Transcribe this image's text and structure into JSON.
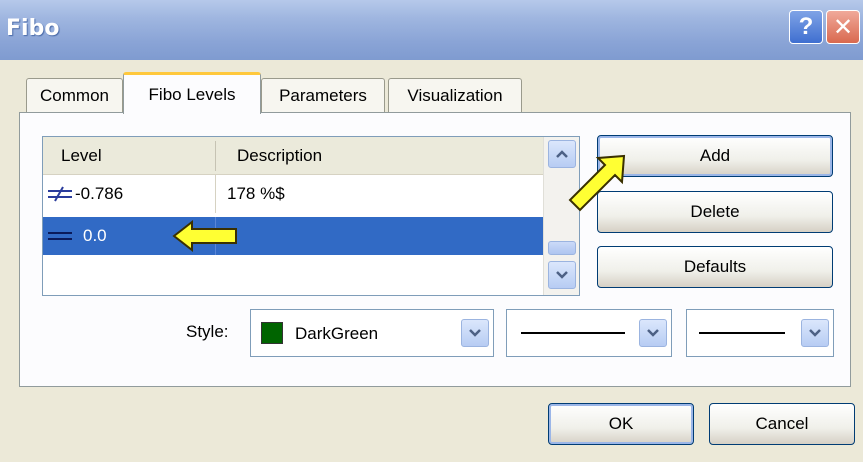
{
  "window": {
    "title": "Fibo"
  },
  "titlebar_buttons": {
    "help": "?",
    "close": "✕"
  },
  "tabs": [
    {
      "label": "Common",
      "active": false
    },
    {
      "label": "Fibo Levels",
      "active": true
    },
    {
      "label": "Parameters",
      "active": false
    },
    {
      "label": "Visualization",
      "active": false
    }
  ],
  "levels_list": {
    "columns": [
      "Level",
      "Description"
    ],
    "rows": [
      {
        "level": "-0.786",
        "description": "178 %$",
        "selected": false
      },
      {
        "level": "0.0",
        "description": "",
        "selected": true
      }
    ]
  },
  "buttons": {
    "add": "Add",
    "delete": "Delete",
    "defaults": "Defaults",
    "ok": "OK",
    "cancel": "Cancel"
  },
  "style": {
    "label": "Style:",
    "color_name": "DarkGreen",
    "color_hex": "#006400",
    "line_style": "solid",
    "line_width": "solid thin"
  },
  "colors": {
    "selection": "#316ac5",
    "arrow_fill": "#ffff33",
    "titlebar": "#8aa4d6"
  },
  "icons": [
    "help-icon",
    "close-icon",
    "level-line-icon",
    "chevron-up-icon",
    "chevron-down-icon",
    "pointer-arrow-icon"
  ]
}
